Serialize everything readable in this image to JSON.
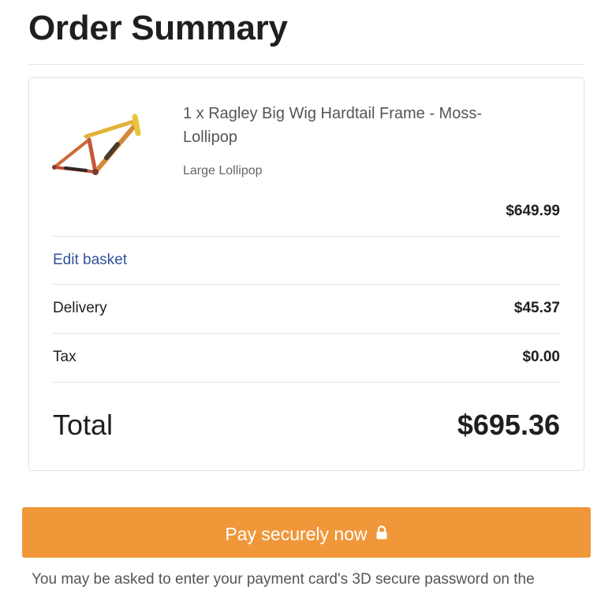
{
  "page": {
    "title": "Order Summary"
  },
  "item": {
    "name": "1 x Ragley Big Wig Hardtail Frame - Moss-Lollipop",
    "variant": "Large Lollipop",
    "price": "$649.99",
    "image_icon": "bike-frame-image"
  },
  "links": {
    "edit_basket": "Edit basket"
  },
  "totals": {
    "delivery_label": "Delivery",
    "delivery_value": "$45.37",
    "tax_label": "Tax",
    "tax_value": "$0.00",
    "total_label": "Total",
    "total_value": "$695.36"
  },
  "payment": {
    "button_label": "Pay securely now",
    "button_icon": "lock-icon",
    "note": "You may be asked to enter your payment card's 3D secure password on the"
  },
  "colors": {
    "accent": "#f0973a",
    "link": "#33539c",
    "text": "#1f1f1f",
    "muted": "#555555",
    "divider": "#e3e3e3"
  }
}
